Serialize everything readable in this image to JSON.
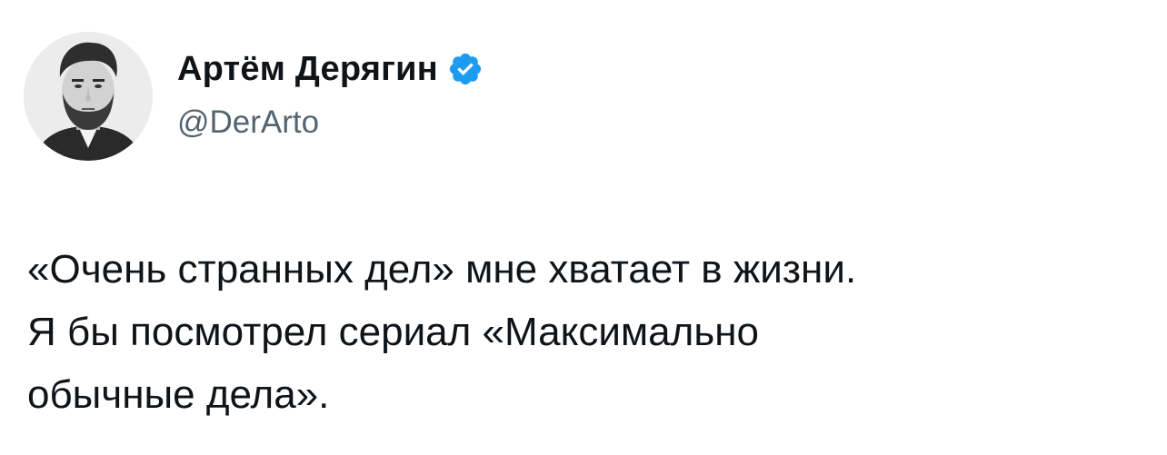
{
  "author": {
    "display_name": "Артём Дерягин",
    "handle": "@DerArto",
    "verified": true,
    "avatar_icon": "portrait-avatar"
  },
  "tweet": {
    "lines": [
      "«Очень странных дел» мне хватает в жизни.",
      "Я бы посмотрел сериал «Максимально",
      "обычные дела»."
    ]
  },
  "colors": {
    "text": "#0f1419",
    "secondary": "#536471",
    "verified_badge": "#1d9bf0",
    "background": "#ffffff"
  }
}
